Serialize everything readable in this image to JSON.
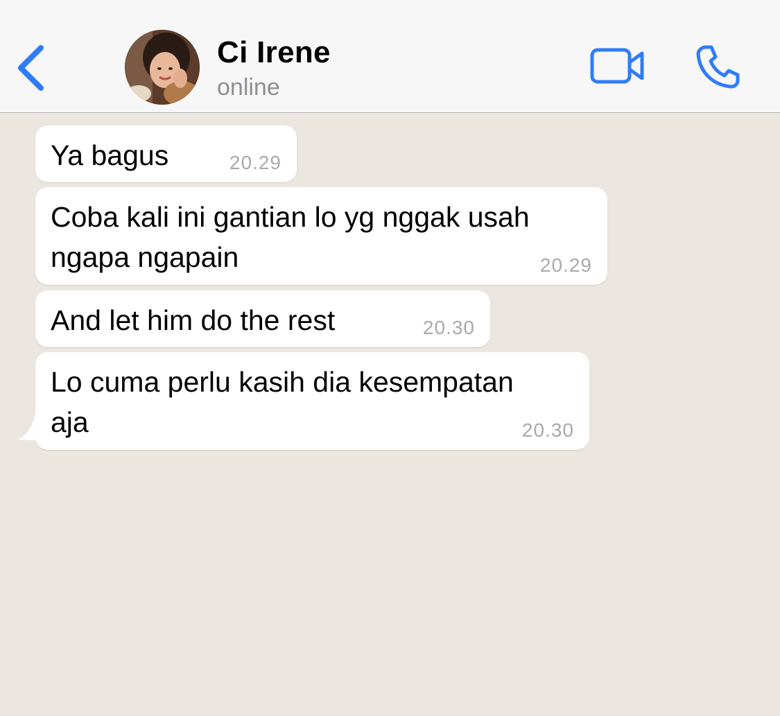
{
  "header": {
    "contact_name": "Ci Irene",
    "status": "online"
  },
  "icons": {
    "back": "chevron-left-icon",
    "video": "video-camera-icon",
    "call": "phone-icon"
  },
  "colors": {
    "accent": "#2f7cf6",
    "chat_background": "#ebe6df",
    "bubble": "#ffffff",
    "timestamp": "#a9a9a9"
  },
  "messages": [
    {
      "lines": [
        "Ya bagus"
      ],
      "time": "20.29"
    },
    {
      "lines": [
        "Coba kali ini gantian lo yg nggak usah",
        "ngapa ngapain"
      ],
      "time": "20.29"
    },
    {
      "lines": [
        "And let him do the rest"
      ],
      "time": "20.30"
    },
    {
      "lines": [
        "Lo cuma perlu kasih dia kesempatan",
        "aja"
      ],
      "time": "20.30"
    }
  ]
}
